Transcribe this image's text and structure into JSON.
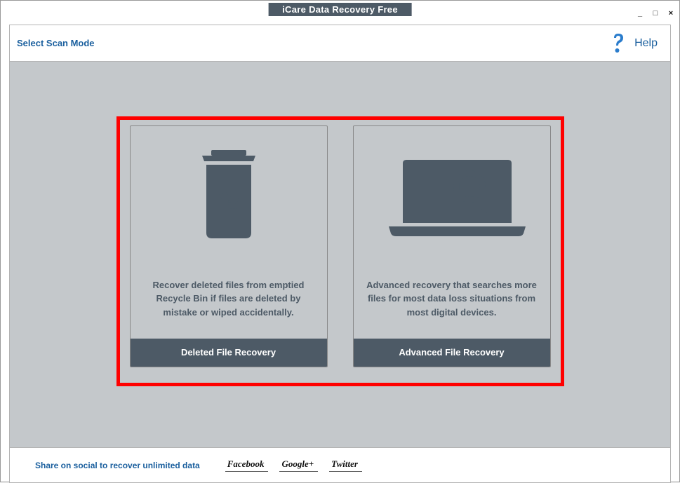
{
  "titlebar": {
    "app_title": "iCare Data Recovery Free",
    "minimize": "_",
    "maximize": "□",
    "close": "×"
  },
  "header": {
    "select_mode": "Select Scan Mode",
    "help": "Help"
  },
  "scan_modes": {
    "deleted": {
      "description": "Recover deleted files from emptied Recycle Bin if files are deleted by mistake or wiped accidentally.",
      "title": "Deleted File Recovery"
    },
    "advanced": {
      "description": "Advanced recovery that searches more files for most data loss situations from most digital devices.",
      "title": "Advanced File Recovery"
    }
  },
  "footer": {
    "share_msg": "Share on social to recover unlimited data",
    "links": {
      "facebook": "Facebook",
      "googleplus": "Google+",
      "twitter": "Twitter"
    }
  }
}
